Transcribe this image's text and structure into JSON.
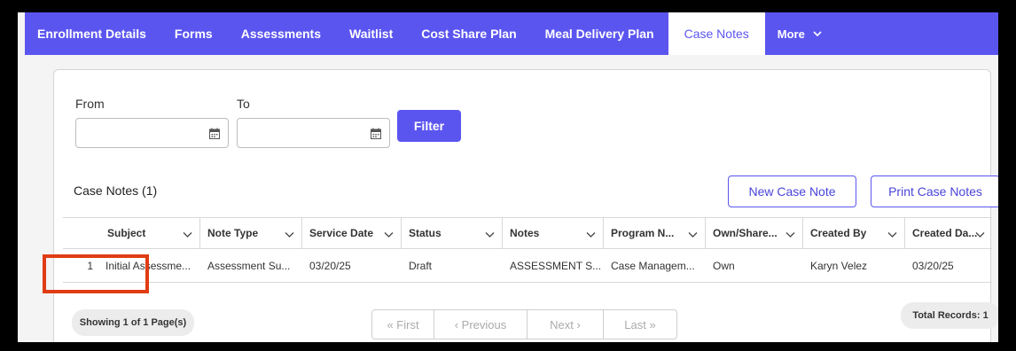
{
  "tabs": [
    {
      "label": "Enrollment Details"
    },
    {
      "label": "Forms"
    },
    {
      "label": "Assessments"
    },
    {
      "label": "Waitlist"
    },
    {
      "label": "Cost Share Plan"
    },
    {
      "label": "Meal Delivery Plan"
    },
    {
      "label": "Case Notes"
    },
    {
      "label": "More"
    }
  ],
  "filters": {
    "from_label": "From",
    "to_label": "To",
    "from_value": "",
    "to_value": "",
    "filter_button": "Filter"
  },
  "section": {
    "title": "Case Notes (1)",
    "new_button": "New Case Note",
    "print_button": "Print Case Notes"
  },
  "table": {
    "columns": [
      "Subject",
      "Note Type",
      "Service Date",
      "Status",
      "Notes",
      "Program N...",
      "Own/Share...",
      "Created By",
      "Created Da..."
    ],
    "rows": [
      {
        "num": "1",
        "subject": "Initial Assessme...",
        "note_type": "Assessment Su...",
        "service_date": "03/20/25",
        "status": "Draft",
        "notes": "ASSESSMENT S...",
        "program": "Case Managem...",
        "own_share": "Own",
        "created_by": "Karyn Velez",
        "created_date": "03/20/25"
      }
    ]
  },
  "footer": {
    "showing": "Showing 1 of 1 Page(s)",
    "first": "« First",
    "previous": "‹ Previous",
    "next": "Next ›",
    "last": "Last »",
    "total": "Total Records: 1"
  },
  "colors": {
    "brand": "#5b55f0",
    "highlight": "#e03c14"
  }
}
